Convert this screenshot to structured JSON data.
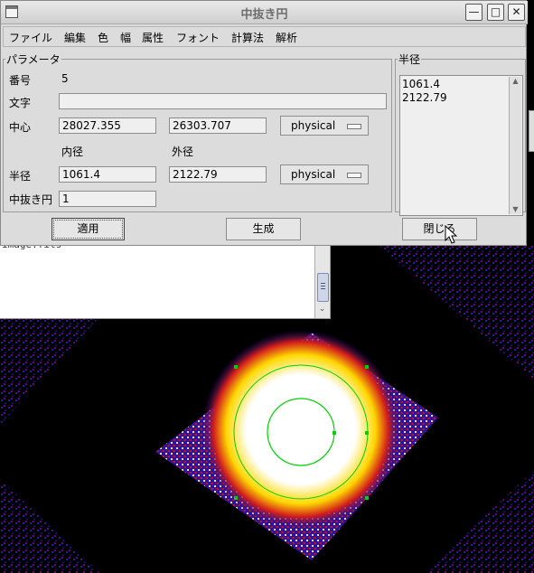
{
  "dialog": {
    "title": "中抜き円",
    "window_buttons": {
      "minimize": "—",
      "maximize": "□",
      "close": "✕"
    }
  },
  "menubar": {
    "items": [
      "ファイル",
      "編集",
      "色",
      "幅",
      "属性",
      "フォント",
      "計算法",
      "解析"
    ]
  },
  "params": {
    "legend": "パラメータ",
    "id_label": "番号",
    "id_value": "5",
    "text_label": "文字",
    "text_value": "",
    "center_label": "中心",
    "center_x": "28027.355",
    "center_y": "26303.707",
    "center_system": "physical",
    "inner_label": "内径",
    "outer_label": "外径",
    "radius_label": "半径",
    "inner_radius": "1061.4",
    "outer_radius": "2122.79",
    "radius_system": "physical",
    "annuli_label": "中抜き円",
    "annuli_value": "1"
  },
  "radius_panel": {
    "legend": "半径",
    "lines": [
      "1061.4",
      "2122.79"
    ]
  },
  "buttons": {
    "apply": "適用",
    "generate": "生成",
    "close": "閉じる"
  },
  "background_terminal": {
    "text": "image.fits"
  },
  "colors": {
    "dialog_bg": "#dcdcdc",
    "field_bg": "#efefef",
    "region_circle": "#00d000"
  },
  "icons": {
    "scroll_up": "▲",
    "scroll_down": "▼"
  }
}
